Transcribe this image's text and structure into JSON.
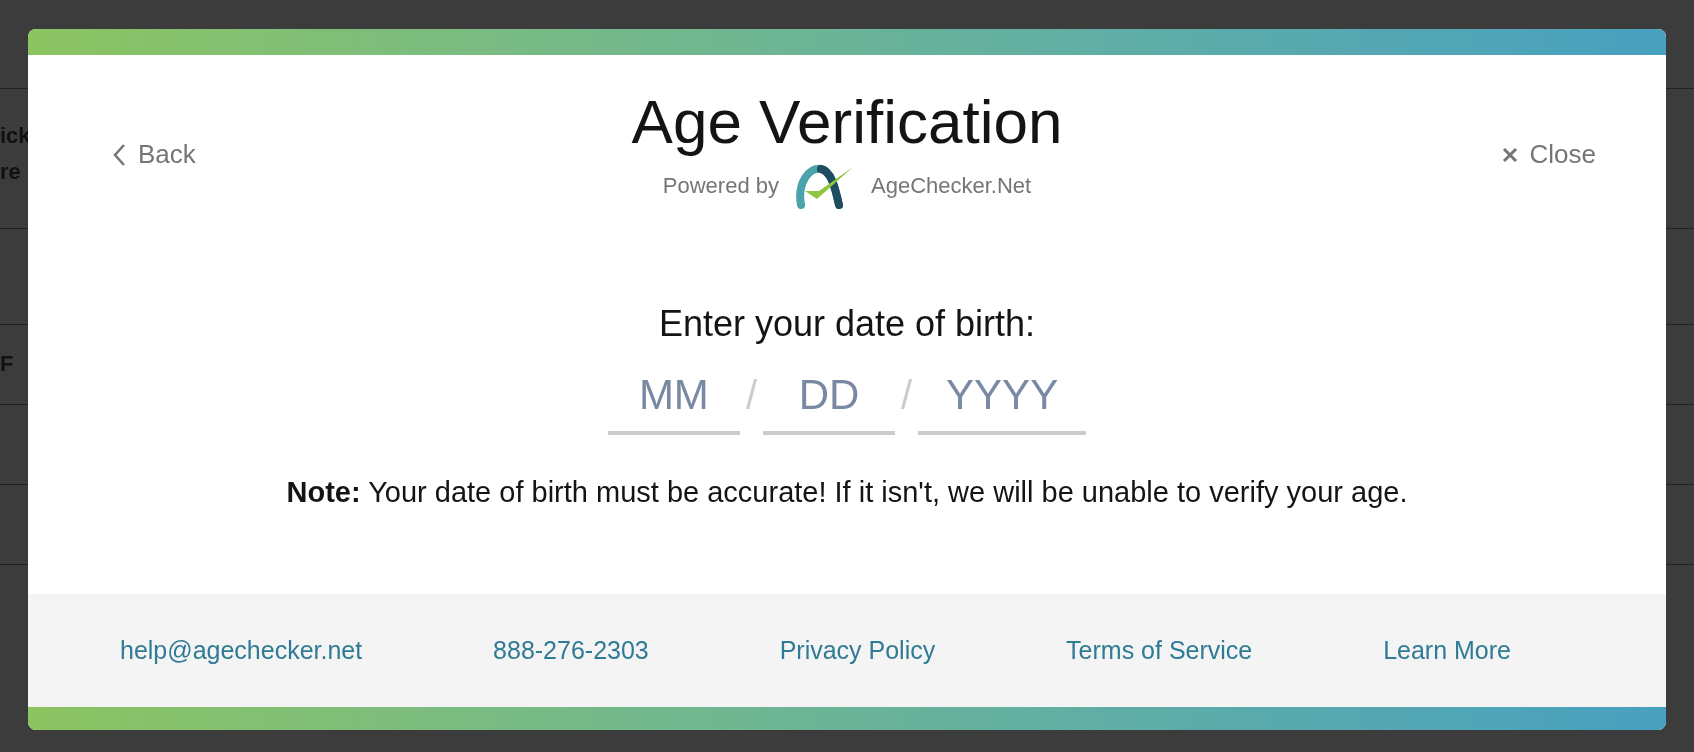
{
  "background": {
    "fragments": [
      "ick",
      "re",
      "F"
    ]
  },
  "modal": {
    "back": "Back",
    "close": "Close",
    "title": "Age Verification",
    "powered_by": "Powered by",
    "brand": "AgeChecker.Net",
    "prompt": "Enter your date of birth:",
    "date_fields": [
      {
        "placeholder": "MM"
      },
      {
        "separator": "/"
      },
      {
        "placeholder": "DD"
      },
      {
        "separator": "/"
      },
      {
        "placeholder": "YYYY"
      }
    ],
    "note": "**Note:** Your date of birth must be accurate! If it isn't, we will be unable to verify your age.",
    "footer_links": [
      "help@agechecker.net",
      "888-276-2303",
      "Privacy Policy",
      "Terms of Service",
      "Learn More"
    ]
  }
}
